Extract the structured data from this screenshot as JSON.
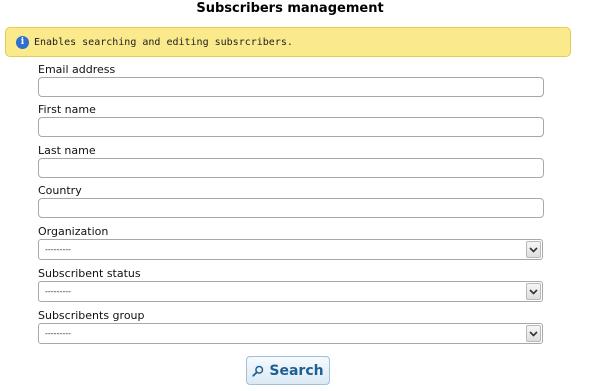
{
  "page": {
    "title": "Subscribers management"
  },
  "info": {
    "icon": "info-icon",
    "text": "Enables searching and editing subsrcribers."
  },
  "form": {
    "email": {
      "label": "Email address",
      "value": ""
    },
    "first_name": {
      "label": "First name",
      "value": ""
    },
    "last_name": {
      "label": "Last name",
      "value": ""
    },
    "country": {
      "label": "Country",
      "value": ""
    },
    "organization": {
      "label": "Organization",
      "selected": "---------"
    },
    "status": {
      "label": "Subscribent status",
      "selected": "---------"
    },
    "group": {
      "label": "Subscribents group",
      "selected": "---------"
    }
  },
  "actions": {
    "search_label": "Search",
    "search_icon": "search-icon"
  },
  "colors": {
    "info_bg": "#faea8c",
    "info_border": "#e4cc55",
    "info_icon": "#2e6fd1",
    "button_text": "#1e5f92"
  }
}
